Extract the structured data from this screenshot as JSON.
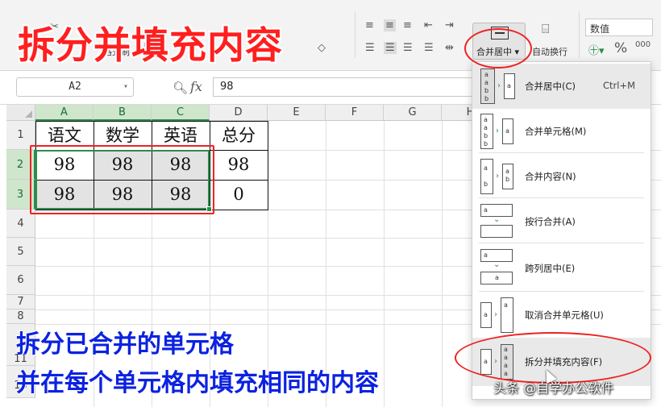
{
  "ribbon": {
    "format_painter": "格式刷",
    "merge_center_label": "合并居中",
    "wrap_text_label": "自动换行",
    "number_format_value": "数值",
    "percent_symbol": "%"
  },
  "formula_bar": {
    "name_box": "A2",
    "fx": "fx",
    "formula_value": "98"
  },
  "grid": {
    "columns": [
      "A",
      "B",
      "C",
      "D",
      "E",
      "F",
      "G",
      "H"
    ],
    "rows": [
      "1",
      "2",
      "3",
      "4",
      "5",
      "6",
      "7",
      "8",
      "11",
      "13"
    ],
    "cells": {
      "A1": "语文",
      "B1": "数学",
      "C1": "英语",
      "D1": "总分",
      "A2": "98",
      "B2": "98",
      "C2": "98",
      "D2": "98",
      "A3": "98",
      "B3": "98",
      "C3": "98",
      "D3": "0"
    }
  },
  "dropdown": {
    "items": [
      {
        "label": "合并居中(C)",
        "shortcut": "Ctrl+M"
      },
      {
        "label": "合并单元格(M)"
      },
      {
        "label": "合并内容(N)"
      },
      {
        "label": "按行合并(A)"
      },
      {
        "label": "跨列居中(E)"
      },
      {
        "label": "取消合并单元格(U)"
      },
      {
        "label": "拆分并填充内容(F)"
      }
    ]
  },
  "overlay": {
    "title": "拆分并填充内容",
    "caption_line1": "拆分已合并的单元格",
    "caption_line2": "并在每个单元格内填充相同的内容",
    "watermark": "头条 @自学办公软件"
  },
  "colors": {
    "accent_green": "#2e8b4b",
    "annotation_red": "#e22222",
    "caption_blue": "#0b22e0"
  }
}
